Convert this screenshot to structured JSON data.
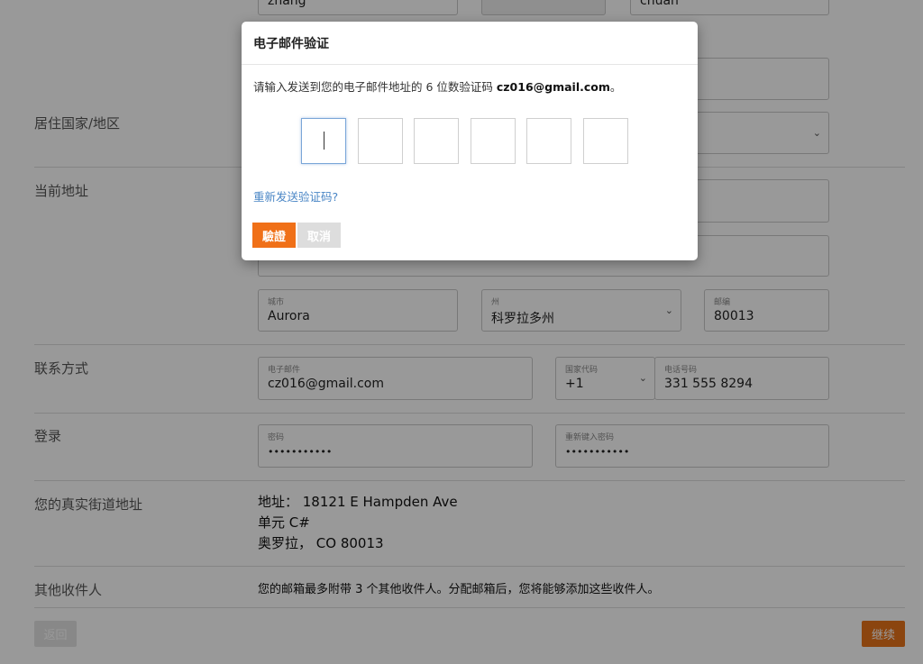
{
  "form": {
    "name_row": {
      "first_name_value": "zhang",
      "last_name_value": "chuan"
    },
    "sections": {
      "country_label": "居住国家/地区",
      "current_address_label": "当前地址",
      "contact_label": "联系方式",
      "login_label": "登录",
      "real_address_label": "您的真实街道地址",
      "other_recipients_label": "其他收件人"
    },
    "address": {
      "city_label": "城市",
      "city_value": "Aurora",
      "state_label": "州",
      "state_value": "科罗拉多州",
      "zip_label": "邮编",
      "zip_value": "80013"
    },
    "contact": {
      "email_label": "电子邮件",
      "email_value": "cz016@gmail.com",
      "country_code_label": "国家代码",
      "country_code_value": "+1",
      "phone_label": "电话号码",
      "phone_value": "331 555 8294"
    },
    "login": {
      "password_label": "密码",
      "password_value": "•••••••••••",
      "confirm_label": "重新键入密码",
      "confirm_value": "•••••••••••"
    },
    "real_address": {
      "line1": "地址：  18121 E Hampden Ave",
      "line2": "单元 C#",
      "line3": "奥罗拉，  CO 80013"
    },
    "recipients_note": "您的邮箱最多附带 3 个其他收件人。分配邮箱后，您将能够添加这些收件人。",
    "back_label": "返回",
    "continue_label": "继续"
  },
  "modal": {
    "title": "电子邮件验证",
    "message_prefix": "请输入发送到您的电子邮件地址的 6 位数验证码 ",
    "message_email": "cz016@gmail.com",
    "message_suffix": "。",
    "code_values": [
      "",
      "",
      "",
      "",
      "",
      ""
    ],
    "resend_label": "重新发送验证码?",
    "verify_label": "驗證",
    "cancel_label": "取消"
  },
  "colors": {
    "accent": "#f07018",
    "link": "#4a86c5",
    "overlay": "rgba(0,0,0,0.40)"
  }
}
